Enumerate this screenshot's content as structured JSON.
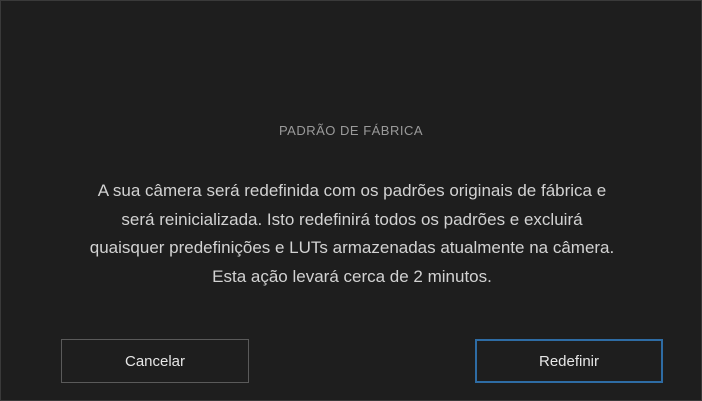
{
  "dialog": {
    "title": "PADRÃO DE FÁBRICA",
    "message_lines": [
      "A sua câmera será redefinida com os padrões originais de fábrica e",
      "será reinicializada. Isto redefinirá todos os padrões e excluirá",
      "quaisquer predefinições e LUTs armazenadas atualmente na câmera.",
      "Esta ação levará cerca de 2 minutos."
    ],
    "cancel_label": "Cancelar",
    "confirm_label": "Redefinir"
  },
  "colors": {
    "background": "#1e1e1e",
    "title_text": "#9a9a9a",
    "body_text": "#d2d2d2",
    "cancel_border": "#5a5a5a",
    "confirm_border": "#2e6ca4"
  }
}
